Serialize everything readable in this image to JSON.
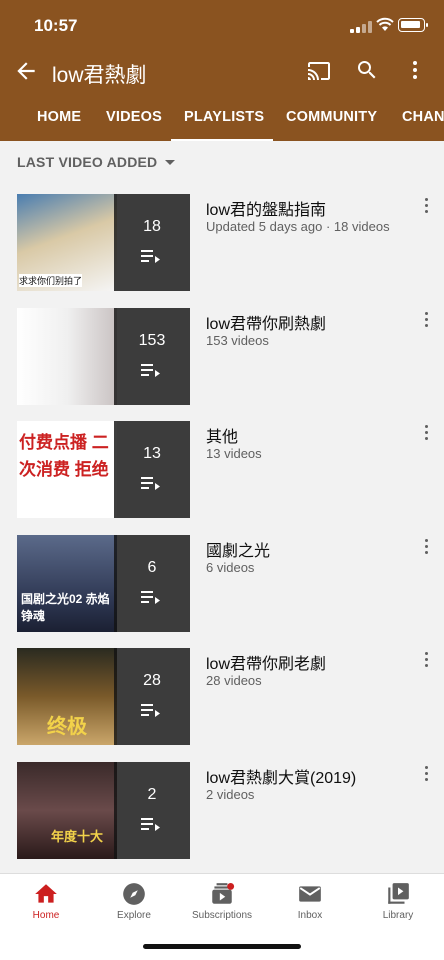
{
  "status": {
    "time": "10:57"
  },
  "appbar": {
    "title": "low君熱劇",
    "icons": [
      "back-arrow-icon",
      "cast-icon",
      "search-icon",
      "more-vert-icon"
    ]
  },
  "tabs": [
    {
      "label": "HOME"
    },
    {
      "label": "VIDEOS"
    },
    {
      "label": "PLAYLISTS",
      "active": true
    },
    {
      "label": "COMMUNITY"
    },
    {
      "label": "CHAN"
    }
  ],
  "sort": {
    "label": "LAST VIDEO ADDED"
  },
  "playlists": [
    {
      "count": "18",
      "title": "low君的盤點指南",
      "subtitle": "Updated 5 days ago · 18 videos",
      "thumb_color": "#3a6a9a",
      "thumb_caption": "求求你们别拍了"
    },
    {
      "count": "153",
      "title": "low君帶你刷熱劇",
      "subtitle": "153 videos",
      "thumb_color": "#eeeeee",
      "thumb_caption": ""
    },
    {
      "count": "13",
      "title": "其他",
      "subtitle": "13 videos",
      "thumb_color": "#ffffff",
      "thumb_caption": "付费点播 二次消费 拒绝"
    },
    {
      "count": "6",
      "title": "國劇之光",
      "subtitle": "6 videos",
      "thumb_color": "#2c3550",
      "thumb_caption": "国剧之光02 赤焰铮魂"
    },
    {
      "count": "28",
      "title": "low君帶你刷老劇",
      "subtitle": "28 videos",
      "thumb_color": "#7a5a2a",
      "thumb_caption": "终极"
    },
    {
      "count": "2",
      "title": "low君熱劇大賞(2019)",
      "subtitle": "2 videos",
      "thumb_color": "#4a3a3a",
      "thumb_caption": "年度十大"
    }
  ],
  "bottom_nav": [
    {
      "label": "Home",
      "icon": "home-icon",
      "active": true
    },
    {
      "label": "Explore",
      "icon": "explore-icon"
    },
    {
      "label": "Subscriptions",
      "icon": "subscriptions-icon"
    },
    {
      "label": "Inbox",
      "icon": "inbox-icon"
    },
    {
      "label": "Library",
      "icon": "library-icon"
    }
  ],
  "colors": {
    "header": "#8a5320",
    "accent": "#cc1f1f"
  }
}
